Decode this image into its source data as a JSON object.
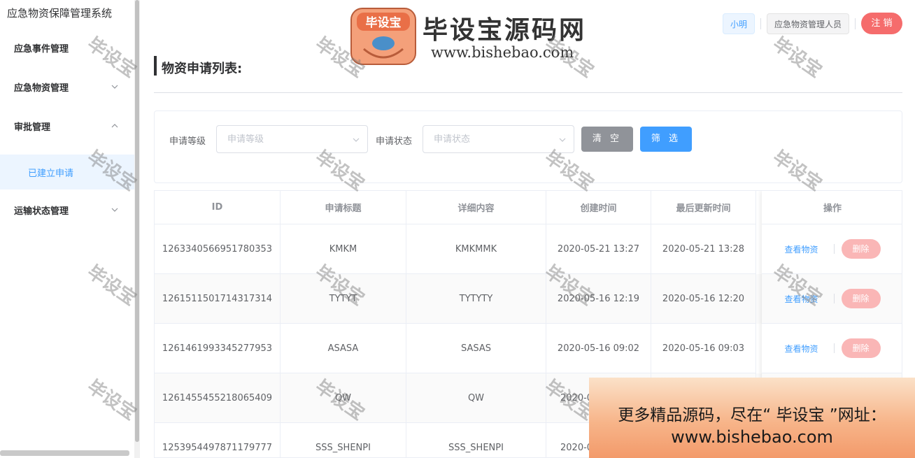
{
  "app": {
    "title": "应急物资保障管理系统"
  },
  "sidebar": {
    "items": [
      {
        "label": "应急事件管理",
        "has_chevron": false
      },
      {
        "label": "应急物资管理",
        "chevron": "chevron-down"
      },
      {
        "label": "审批管理",
        "chevron": "chevron-up"
      },
      {
        "label": "已建立申请",
        "active": true
      },
      {
        "label": "运输状态管理",
        "chevron": "chevron-down"
      }
    ]
  },
  "brand": {
    "logo_text": "毕设宝",
    "name": "毕设宝源码网",
    "url": "www.bishebao.com"
  },
  "header": {
    "user": "小明",
    "role": "应急物资管理人员",
    "logout_label": "注 销"
  },
  "page": {
    "title": "物资申请列表:"
  },
  "filter": {
    "level_label": "申请等级",
    "level_placeholder": "申请等级",
    "status_label": "申请状态",
    "status_placeholder": "申请状态",
    "clear_label": "清 空",
    "filter_label": "筛 选"
  },
  "table": {
    "columns": [
      "ID",
      "申请标题",
      "详细内容",
      "创建时间",
      "最后更新时间",
      "操作"
    ],
    "rows": [
      {
        "id": "1263340566951780353",
        "title": "KMKM",
        "detail": "KMKMMK",
        "created": "2020-05-21 13:27",
        "updated": "2020-05-21 13:28"
      },
      {
        "id": "1261511501714317314",
        "title": "TYTYT",
        "detail": "TYTYTY",
        "created": "2020-05-16 12:19",
        "updated": "2020-05-16 12:20"
      },
      {
        "id": "1261461993345277953",
        "title": "ASASA",
        "detail": "SASAS",
        "created": "2020-05-16 09:02",
        "updated": "2020-05-16 09:03"
      },
      {
        "id": "1261455455218065409",
        "title": "QW",
        "detail": "QW",
        "created": "2020-0",
        "updated": ""
      },
      {
        "id": "1253954497871179777",
        "title": "SSS_SHENPI",
        "detail": "SSS_SHENPI",
        "created": "2020-0",
        "updated": ""
      }
    ],
    "actions": {
      "view": "查看物资",
      "delete": "删除"
    }
  },
  "watermark": "毕设宝",
  "promo": {
    "line1": "更多精品源码，尽在“ 毕设宝 ”网址：",
    "line2": "www.bishebao.com"
  },
  "colors": {
    "primary": "#409eff",
    "danger": "#f56c6c",
    "danger_light": "#fab6b6",
    "neutral": "#909399",
    "active_bg": "#ecf5ff"
  }
}
